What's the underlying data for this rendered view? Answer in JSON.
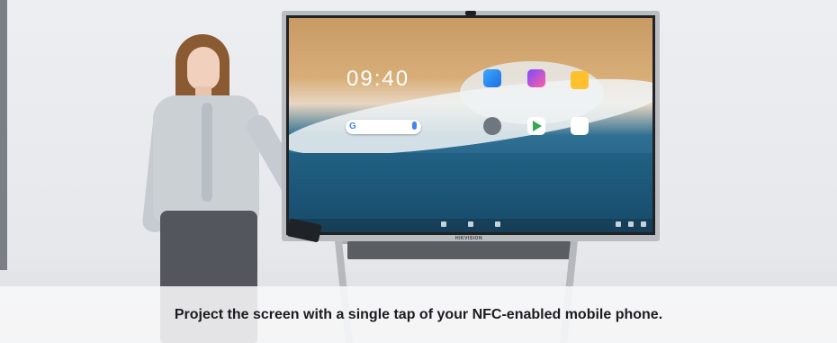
{
  "scene": {
    "product_brand": "HIKVISION",
    "clock": "09:40"
  },
  "caption": {
    "text": "Project the screen with a single tap of your NFC-enabled mobile phone."
  },
  "colors": {
    "caption_background": "#f8f8f9",
    "caption_text": "#1b1c1f"
  },
  "icons": [
    "google-icon",
    "mic-icon",
    "screen-cast-icon",
    "whiteboard-pen-icon",
    "folder-icon",
    "settings-gear-icon",
    "play-store-icon",
    "google-apps-icon"
  ]
}
